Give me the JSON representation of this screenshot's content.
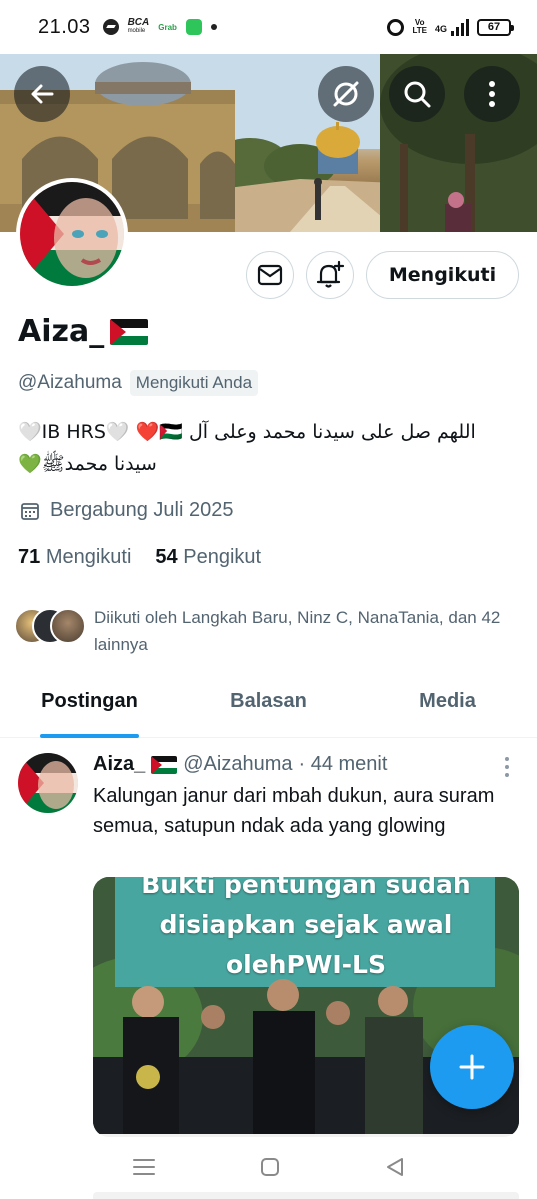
{
  "status_bar": {
    "time": "21.03",
    "bca_label": "BCA",
    "bca_sub": "mobile",
    "grab_label": "Grab",
    "volte_label_1": "Vo",
    "volte_label_2": "LTE",
    "network": "4G",
    "battery": "67"
  },
  "profile": {
    "display_name": "Aiza_",
    "handle": "@Aizahuma",
    "follows_you": "Mengikuti Anda",
    "bio_line1": "اللهم صل على سيدنا محمد وعلى آل IB HRS🤍 ❤️🇵🇸🤍",
    "bio_line2": "سيدنا محمدﷺ💚",
    "joined": "Bergabung Juli 2025",
    "following_count": "71",
    "following_label": "Mengikuti",
    "followers_count": "54",
    "followers_label": "Pengikut",
    "followed_by": "Diikuti oleh Langkah Baru, Ninz C, NanaTania, dan 42 lainnya"
  },
  "actions": {
    "follow_label": "Mengikuti"
  },
  "tabs": [
    {
      "label": "Postingan"
    },
    {
      "label": "Balasan"
    },
    {
      "label": "Media"
    }
  ],
  "post": {
    "author_name": "Aiza_",
    "author_handle": "@Aizahuma",
    "time": "· 44 menit",
    "text": "Kalungan janur dari mbah dukun, aura suram semua, satupun ndak ada yang glowing",
    "media_line1": "Bukti pentungan sudah",
    "media_line2": "disiapkan sejak awal",
    "media_line3": "olehPWI-LS"
  },
  "colors": {
    "accent": "#1d9bf0",
    "text_secondary": "#536471",
    "palestine_red": "#ce1126",
    "palestine_green": "#007a3d"
  },
  "icons": [
    "back-arrow-icon",
    "grok-icon",
    "search-icon",
    "more-vertical-icon",
    "mail-icon",
    "bell-plus-icon",
    "calendar-icon",
    "plus-icon",
    "menu-icon",
    "home-square-icon",
    "back-triangle-icon"
  ]
}
